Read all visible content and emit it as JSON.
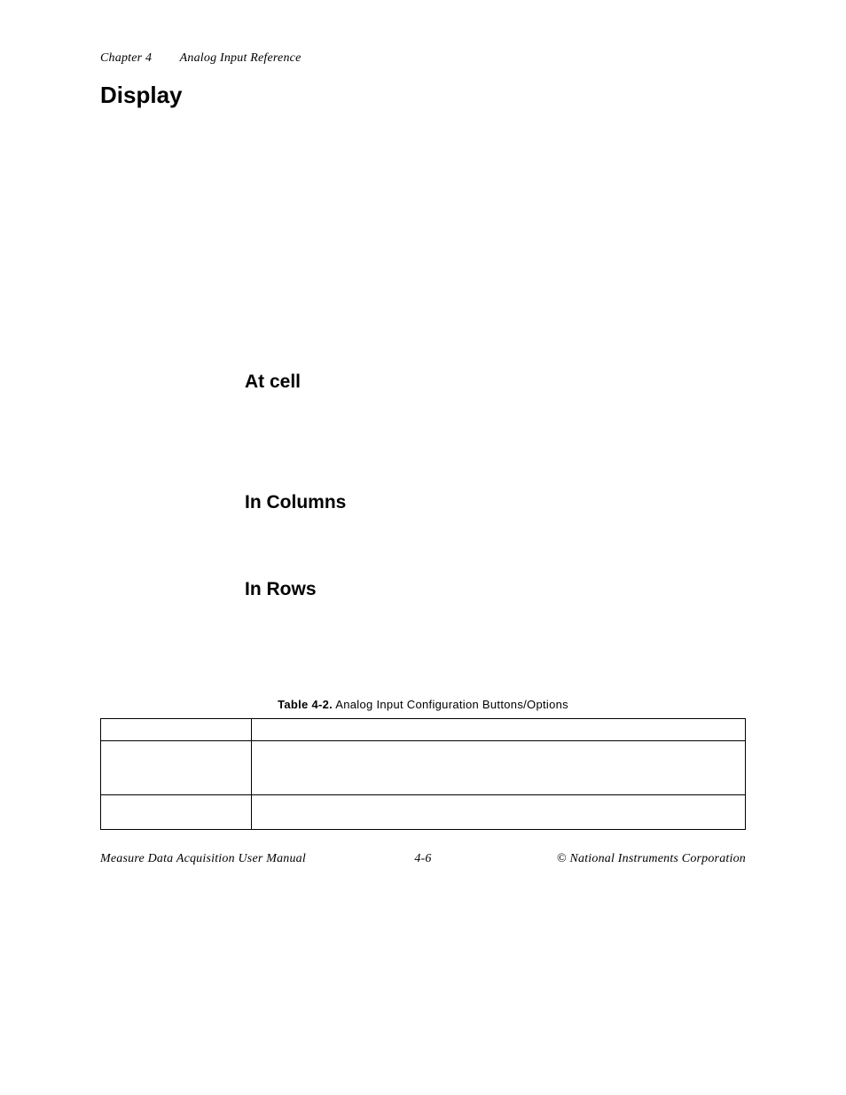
{
  "header": {
    "chapter": "Chapter 4",
    "title": "Analog Input Reference"
  },
  "headings": {
    "display": "Display",
    "at_cell": "At cell",
    "in_columns": "In Columns",
    "in_rows": "In Rows"
  },
  "table": {
    "caption_label": "Table 4-2.",
    "caption_text": "Analog Input Configuration Buttons/Options"
  },
  "footer": {
    "left": "Measure Data Acquisition User Manual",
    "center": "4-6",
    "right": "© National Instruments Corporation"
  }
}
